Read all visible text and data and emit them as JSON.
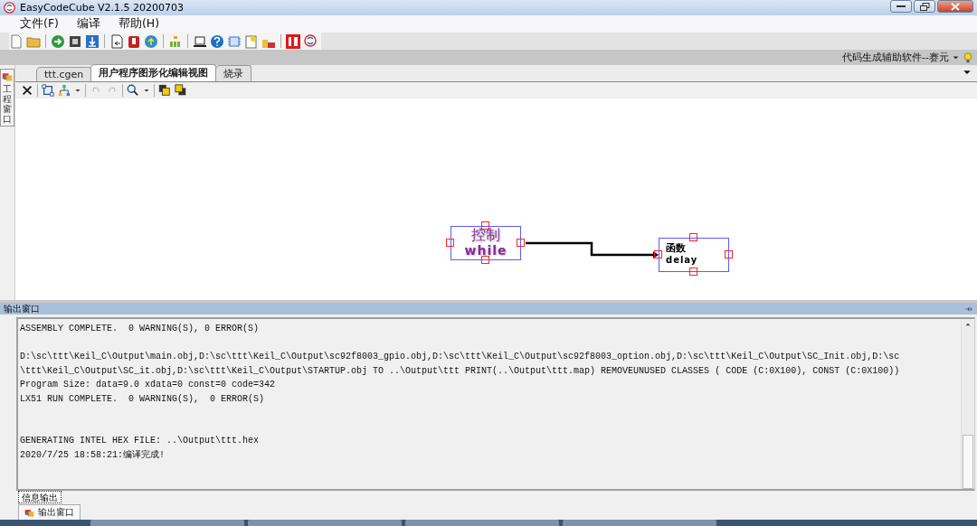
{
  "window": {
    "title": "EasyCodeCube V2.1.5 20200703"
  },
  "menu": [
    {
      "label": "文件(F)"
    },
    {
      "label": "编译"
    },
    {
      "label": "帮助(H)"
    }
  ],
  "hint_bar": {
    "text": "代码生成辅助软件--赛元"
  },
  "side_panel": {
    "label": "工程窗口"
  },
  "tabs": [
    {
      "label": "ttt.cgen",
      "selected": false
    },
    {
      "label": "用户程序图形化编辑视图",
      "selected": true
    },
    {
      "label": "烧录",
      "selected": false
    }
  ],
  "diagram": {
    "nodes": [
      {
        "kind": "control",
        "title": "控制",
        "subtitle": "while"
      },
      {
        "kind": "function",
        "title": "函数",
        "subtitle": "delay"
      }
    ]
  },
  "output": {
    "title": "输出窗口",
    "lines": [
      {
        "kind": "line",
        "text": "ASSEMBLY COMPLETE.  0 WARNING(S), 0 ERROR(S)"
      },
      {
        "kind": "gap",
        "text": "D:\\sc\\ttt\\Keil_C\\Output\\main.obj,D:\\sc\\ttt\\Keil_C\\Output\\sc92f8003_gpio.obj,D:\\sc\\ttt\\Keil_C\\Output\\sc92f8003_option.obj,D:\\sc\\ttt\\Keil_C\\Output\\SC_Init.obj,D:\\sc"
      },
      {
        "kind": "line",
        "text": "\\ttt\\Keil_C\\Output\\SC_it.obj,D:\\sc\\ttt\\Keil_C\\Output\\STARTUP.obj TO ..\\Output\\ttt PRINT(..\\Output\\ttt.map) REMOVEUNUSED CLASSES ( CODE (C:0X100), CONST (C:0X100))"
      },
      {
        "kind": "line",
        "text": "Program Size: data=9.0 xdata=0 const=0 code=342"
      },
      {
        "kind": "line",
        "text": "LX51 RUN COMPLETE.  0 WARNING(S),  0 ERROR(S)"
      },
      {
        "kind": "wide_gap",
        "text": "GENERATING INTEL HEX FILE: ..\\Output\\ttt.hex"
      },
      {
        "kind": "line",
        "text": "2020/7/25 18:58:21:编译完成!"
      }
    ]
  },
  "output_tabs": [
    {
      "label": "信息输出",
      "selected": true
    }
  ],
  "dock_tabs": [
    {
      "label": "输出窗口"
    }
  ]
}
